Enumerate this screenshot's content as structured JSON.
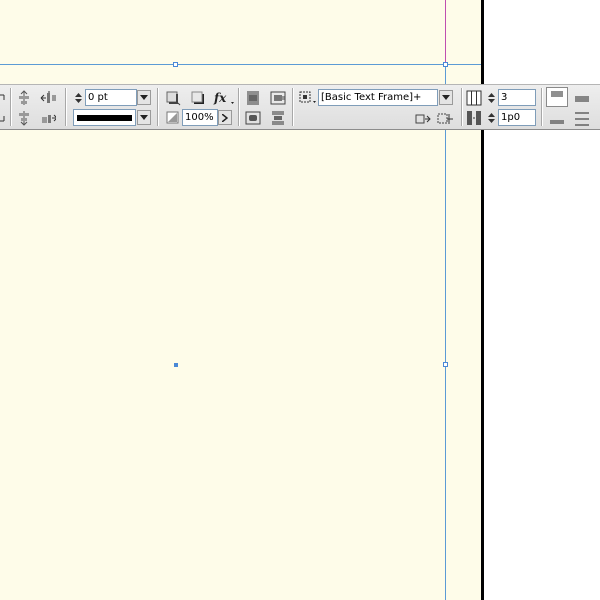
{
  "control_panel": {
    "stroke_weight": {
      "value": "0 pt"
    },
    "stroke_type": {
      "style": "solid"
    },
    "opacity": {
      "value": "100%"
    },
    "object_style": {
      "value": "[Basic Text Frame]+"
    },
    "columns": {
      "value": "3"
    },
    "gutter": {
      "value": "1p0"
    }
  },
  "icons": {
    "align_group": [
      "distribute-top-icon",
      "distribute-horizontal-icon",
      "distribute-bottom-icon",
      "distribute-vertical-icon"
    ],
    "effects": [
      "drop-shadow-icon",
      "shadow-icon",
      "fx-icon",
      "opacity-icon"
    ],
    "text_wrap": [
      "wrap-none-icon",
      "wrap-bbox-icon",
      "wrap-shape-icon",
      "wrap-jump-icon"
    ],
    "frame": [
      "frame-fitting-icon",
      "fit-content-icon",
      "fit-frame-icon",
      "columns-icon",
      "gutter-icon"
    ],
    "align": [
      "align-top-icon",
      "align-center-icon",
      "align-bottom-icon"
    ]
  },
  "colors": {
    "page": "#fefce9",
    "pasteboard": "#ffffff",
    "frame_guide": "#5b9bd5",
    "margin_guide": "#c04fb0",
    "panel": "#e6e6e6"
  }
}
